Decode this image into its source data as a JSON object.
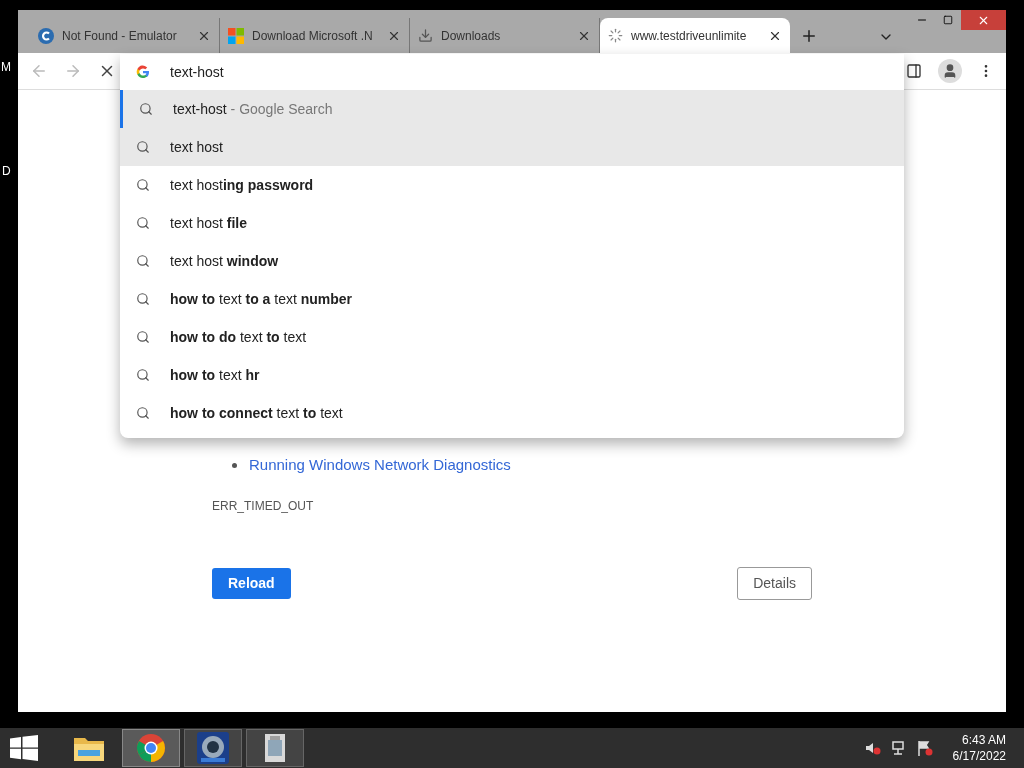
{
  "desktop": {
    "fragments": [
      "M",
      "D"
    ]
  },
  "tabs": [
    {
      "title": "Not Found - Emulator",
      "selected": false,
      "loading": false
    },
    {
      "title": "Download Microsoft .N",
      "selected": false,
      "loading": false
    },
    {
      "title": "Downloads",
      "selected": false,
      "loading": false
    },
    {
      "title": "www.testdriveunlimite",
      "selected": true,
      "loading": true
    }
  ],
  "omnibox": {
    "value": "text-host"
  },
  "suggestions": [
    {
      "text": "text-host",
      "suffix": " - Google Search",
      "selected": true,
      "hovered": false
    },
    {
      "text": "text host",
      "selected": false,
      "hovered": true
    },
    {
      "text": "text host**ing password**",
      "selected": false,
      "hovered": false
    },
    {
      "text": "text host **file**",
      "selected": false,
      "hovered": false
    },
    {
      "text": "text host **window**",
      "selected": false,
      "hovered": false
    },
    {
      "text": "**how to** text **to a** text **number**",
      "selected": false,
      "hovered": false
    },
    {
      "text": "**how to do** text **to** text",
      "selected": false,
      "hovered": false
    },
    {
      "text": "**how to** text **hr**",
      "selected": false,
      "hovered": false
    },
    {
      "text": "**how to connect** text **to** text",
      "selected": false,
      "hovered": false
    }
  ],
  "page": {
    "links": [
      "Running Windows Network Diagnostics"
    ],
    "error_code": "ERR_TIMED_OUT",
    "buttons": {
      "reload": "Reload",
      "details": "Details"
    }
  },
  "taskbar": {
    "apps": [
      {
        "kind": "folder",
        "selected": false
      },
      {
        "kind": "chrome",
        "selected": true
      },
      {
        "kind": "wheel",
        "selected": false
      },
      {
        "kind": "installer",
        "selected": false
      }
    ],
    "time": "6:43 AM",
    "date": "6/17/2022"
  }
}
